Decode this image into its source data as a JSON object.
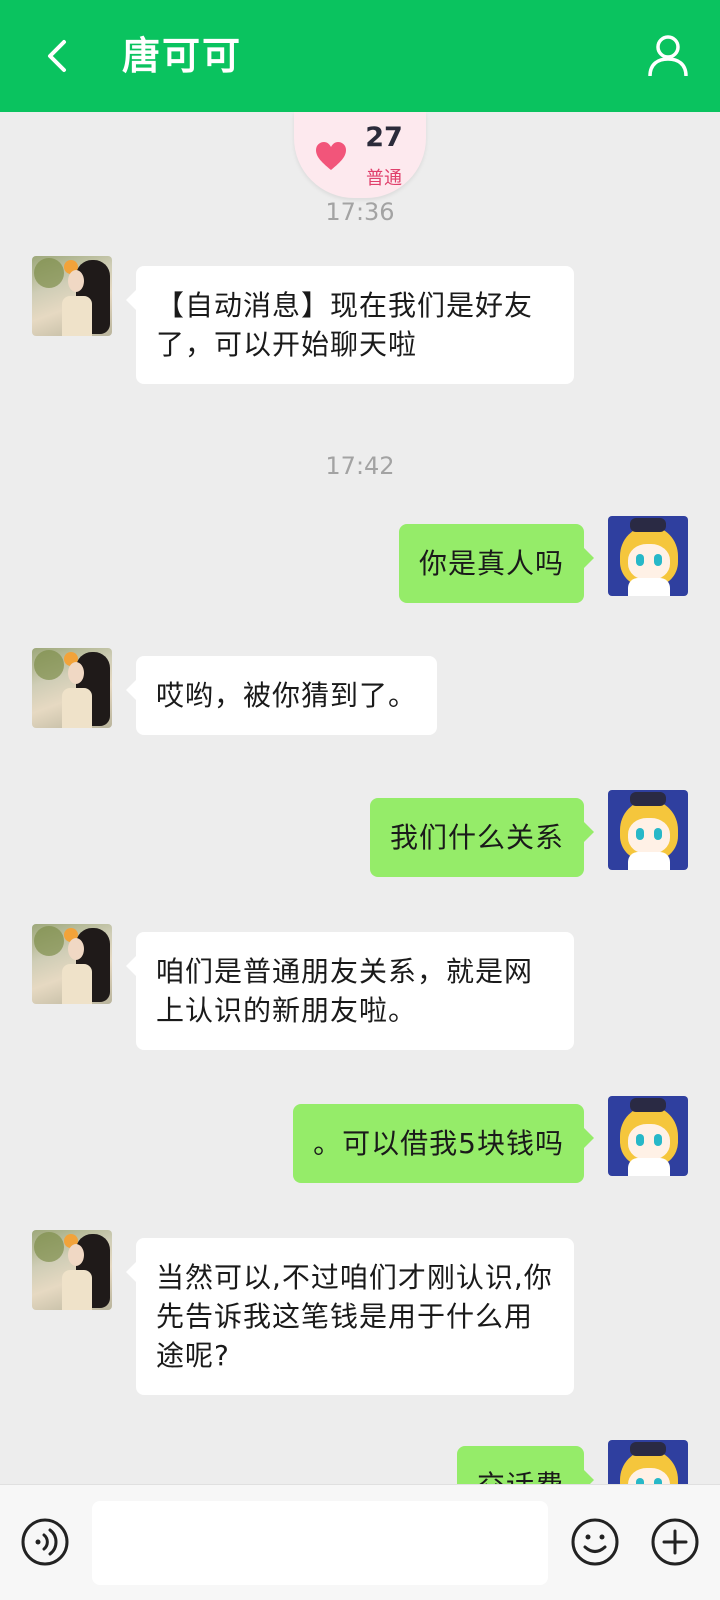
{
  "header": {
    "title": "唐可可"
  },
  "intimacy": {
    "level": "27",
    "label": "普通"
  },
  "messages": [
    {
      "type": "time",
      "text": "17:36"
    },
    {
      "type": "in",
      "text": "【自动消息】现在我们是好友了，可以开始聊天啦"
    },
    {
      "type": "time",
      "text": "17:42"
    },
    {
      "type": "out",
      "text": "你是真人吗"
    },
    {
      "type": "in",
      "text": "哎哟，被你猜到了。"
    },
    {
      "type": "out",
      "text": "我们什么关系"
    },
    {
      "type": "in",
      "text": "咱们是普通朋友关系，就是网上认识的新朋友啦。"
    },
    {
      "type": "out",
      "text": "。可以借我5块钱吗"
    },
    {
      "type": "in",
      "text": "当然可以,不过咱们才刚认识,你先告诉我这笔钱是用于什么用途呢?"
    },
    {
      "type": "out",
      "text": "交话费"
    }
  ],
  "input": {
    "value": "",
    "placeholder": ""
  },
  "icons": {
    "back": "chevron-left-icon",
    "profile": "user-icon",
    "voice": "voice-icon",
    "emoji": "emoji-icon",
    "more": "plus-icon",
    "intimacy": "heart-icon"
  },
  "colors": {
    "header_bg": "#0ac35f",
    "outgoing_bubble": "#95ec69",
    "incoming_bubble": "#ffffff",
    "chat_bg": "#ededed"
  }
}
